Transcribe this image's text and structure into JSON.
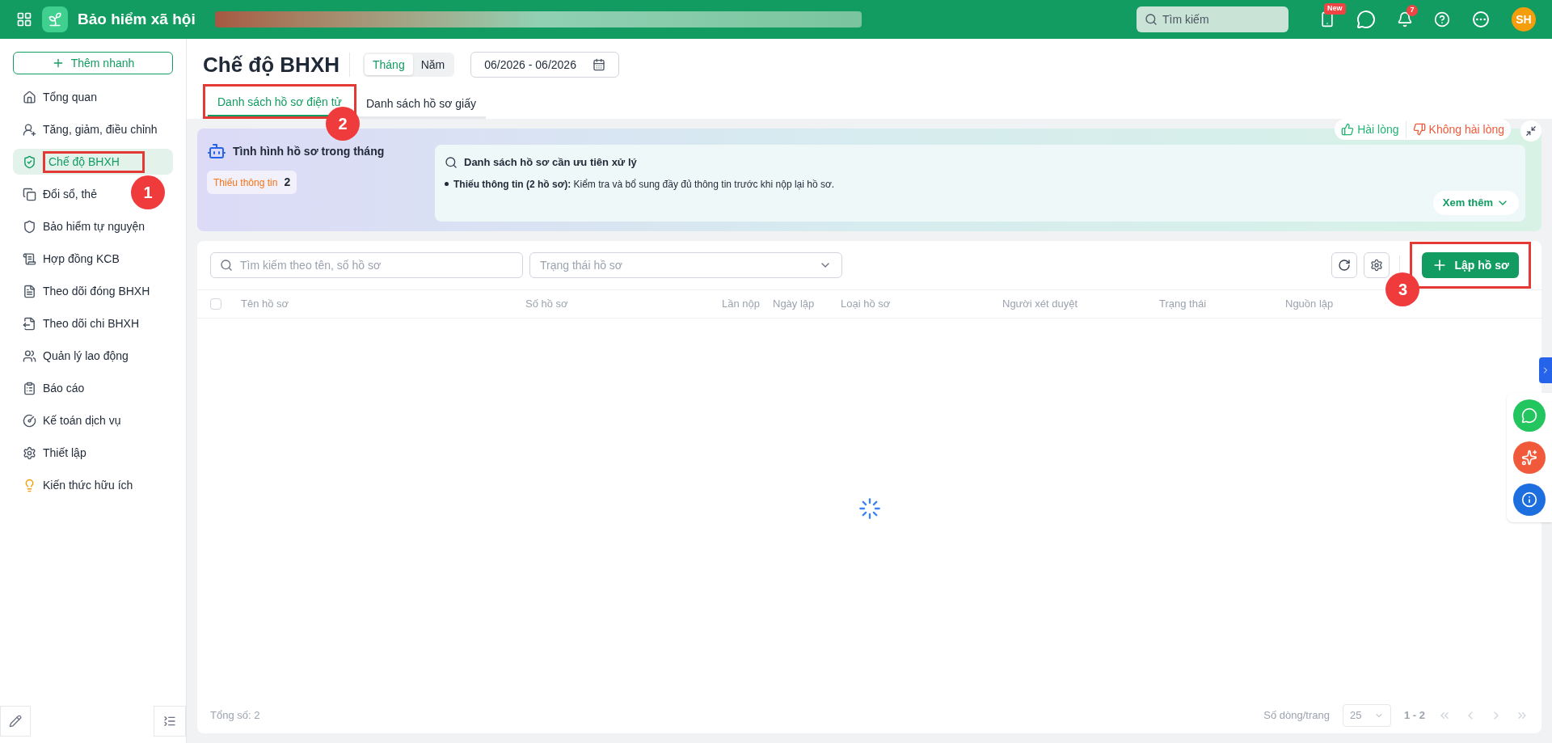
{
  "topbar": {
    "app_name": "Bảo hiểm xã hội",
    "search": {
      "placeholder": "Tìm kiếm"
    },
    "new_badge": "New",
    "notification_count": "7",
    "avatar": "SH"
  },
  "sidebar": {
    "quick_add": "Thêm nhanh",
    "items": [
      {
        "label": "Tổng quan",
        "selected": false
      },
      {
        "label": "Tăng, giảm, điều chỉnh",
        "selected": false
      },
      {
        "label": "Chế độ BHXH",
        "selected": true
      },
      {
        "label": "Đổi sổ, thẻ",
        "selected": false
      },
      {
        "label": "Bảo hiểm tự nguyện",
        "selected": false
      },
      {
        "label": "Hợp đồng KCB",
        "selected": false
      },
      {
        "label": "Theo dõi đóng BHXH",
        "selected": false
      },
      {
        "label": "Theo dõi chi BHXH",
        "selected": false
      },
      {
        "label": "Quản lý lao động",
        "selected": false
      },
      {
        "label": "Báo cáo",
        "selected": false
      },
      {
        "label": "Kế toán dịch vụ",
        "selected": false
      },
      {
        "label": "Thiết lập",
        "selected": false
      },
      {
        "label": "Kiến thức hữu ích",
        "selected": false
      }
    ]
  },
  "page": {
    "title": "Chế độ BHXH",
    "period_toggle": [
      {
        "label": "Tháng",
        "selected": true
      },
      {
        "label": "Năm",
        "selected": false
      }
    ],
    "date_range": "06/2026 - 06/2026"
  },
  "tabs": [
    {
      "label": "Danh sách hồ sơ điện tử",
      "selected": true
    },
    {
      "label": "Danh sách hồ sơ giấy",
      "selected": false
    }
  ],
  "summary": {
    "title": "Tình hình hồ sơ trong tháng",
    "stats": [
      {
        "label": "Thiếu thông tin",
        "count": "2"
      }
    ],
    "feedback": [
      {
        "label": "Hài lòng",
        "kind": "positive"
      },
      {
        "label": "Không hài lòng",
        "kind": "negative"
      }
    ],
    "priority": {
      "title": "Danh sách hồ sơ cần ưu tiên xử lý",
      "items": [
        {
          "label": "Thiếu thông tin (2 hồ sơ):",
          "text": "Kiểm tra và bổ sung đầy đủ thông tin trước khi nộp lại hồ sơ."
        }
      ]
    },
    "more": "Xem thêm"
  },
  "table": {
    "search_placeholder": "Tìm kiếm theo tên, số hồ sơ",
    "status_placeholder": "Trạng thái hồ sơ",
    "create_button": "Lập hồ sơ",
    "loading": true,
    "select_all_checked": false,
    "columns": [
      "Tên hồ sơ",
      "Số hồ sơ",
      "Lần nộp",
      "Ngày lập",
      "Loại hồ sơ",
      "Người xét duyệt",
      "Trạng thái",
      "Nguồn lập"
    ]
  },
  "footer": {
    "total": "Tổng số: 2",
    "rows_per_page_label": "Số dòng/trang",
    "rows_per_page": "25",
    "range": "1 - 2"
  },
  "annotations": [
    {
      "label": "1"
    },
    {
      "label": "2"
    },
    {
      "label": "3"
    }
  ]
}
